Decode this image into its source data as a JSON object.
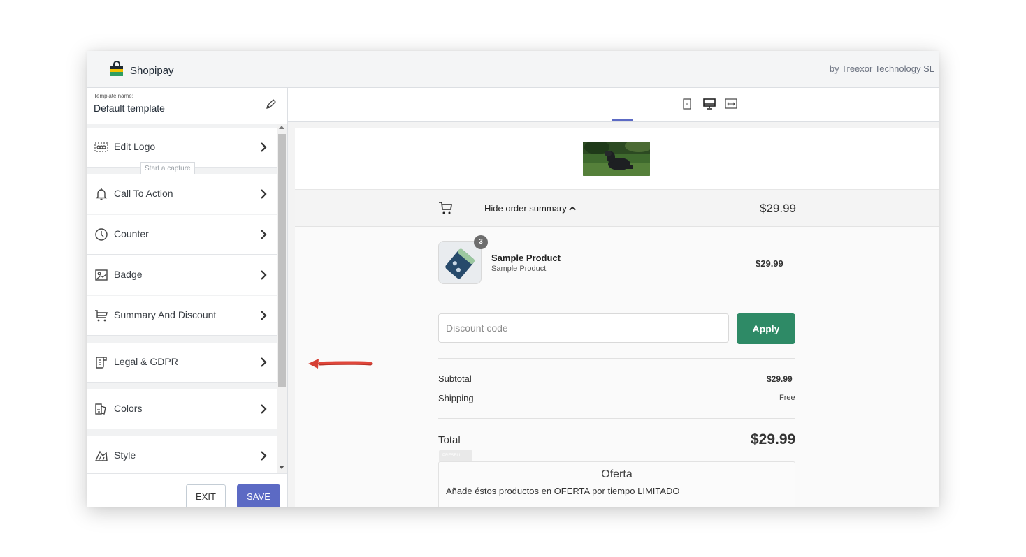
{
  "app": {
    "name": "Shopipay",
    "byline": "by Treexor Technology SL"
  },
  "template": {
    "name_label": "Template name:",
    "name_value": "Default template"
  },
  "sidebar": {
    "items": [
      {
        "label": "Edit Logo",
        "icon": "logo-grid-icon"
      },
      {
        "label": "Call To Action",
        "icon": "bell-icon"
      },
      {
        "label": "Counter",
        "icon": "clock-icon"
      },
      {
        "label": "Badge",
        "icon": "image-icon"
      },
      {
        "label": "Summary And Discount",
        "icon": "cart-icon"
      },
      {
        "label": "Legal & GDPR",
        "icon": "document-icon"
      },
      {
        "label": "Colors",
        "icon": "palette-icon"
      },
      {
        "label": "Style",
        "icon": "style-icon"
      }
    ],
    "tooltip": "Start a capture"
  },
  "footer": {
    "exit_label": "EXIT",
    "save_label": "SAVE"
  },
  "device_toggle": {
    "options": [
      "mobile",
      "desktop",
      "fullwidth"
    ],
    "selected": "desktop"
  },
  "preview": {
    "summary_toggle": "Hide order summary",
    "summary_total": "$29.99",
    "product": {
      "quantity": "3",
      "name": "Sample Product",
      "variant": "Sample Product",
      "price": "$29.99"
    },
    "discount": {
      "placeholder": "Discount code",
      "apply_label": "Apply"
    },
    "subtotal_label": "Subtotal",
    "subtotal_value": "$29.99",
    "shipping_label": "Shipping",
    "shipping_value": "Free",
    "total_label": "Total",
    "total_value": "$29.99",
    "presell_badge": "PRESELL",
    "offer": {
      "title": "Oferta",
      "description": "Añade éstos productos en OFERTA por tiempo LIMITADO"
    }
  },
  "colors": {
    "accent": "#5c6ac4",
    "apply_green": "#2e8a66",
    "annotation_arrow": "#e0463a"
  }
}
